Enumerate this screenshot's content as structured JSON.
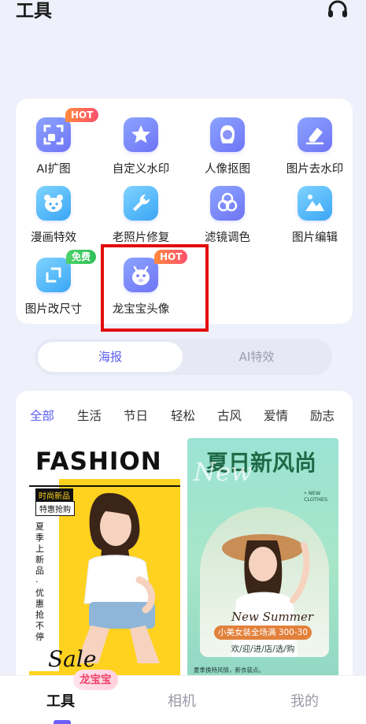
{
  "header": {
    "title": "工具"
  },
  "tools": [
    {
      "label": "AI扩图",
      "icon": "expand-icon",
      "badge": "HOT"
    },
    {
      "label": "自定义水印",
      "icon": "star-icon"
    },
    {
      "label": "人像抠图",
      "icon": "portrait-icon"
    },
    {
      "label": "图片去水印",
      "icon": "eraser-icon"
    },
    {
      "label": "漫画特效",
      "icon": "bear-icon"
    },
    {
      "label": "老照片修复",
      "icon": "wrench-icon"
    },
    {
      "label": "滤镜调色",
      "icon": "color-filter-icon"
    },
    {
      "label": "图片编辑",
      "icon": "image-edit-icon"
    },
    {
      "label": "图片改尺寸",
      "icon": "resize-icon",
      "badge": "免费"
    },
    {
      "label": "龙宝宝头像",
      "icon": "dragon-avatar-icon",
      "badge": "HOT"
    }
  ],
  "segments": {
    "active": "海报",
    "inactive": "AI特效"
  },
  "categories": [
    "全部",
    "生活",
    "节日",
    "轻松",
    "古风",
    "爱情",
    "励志"
  ],
  "posters": {
    "fashion": {
      "headline": "FASHION",
      "tag1": "时尚新品",
      "tag2": "特惠抢购",
      "vertical": "夏季上新品·优惠抢不停",
      "script": "Sale"
    },
    "summer": {
      "headline": "夏日新风尚",
      "script_top": "New",
      "corner": "• NEW CLOTHES",
      "script": "New Summer",
      "banner": "小美女装全场满 300-30",
      "slogan": "欢/迎/进/店/选/购",
      "footer": "夏季换特风情，新衣装点。"
    }
  },
  "tabbar": {
    "tools": "工具",
    "camera": "相机",
    "mine": "我的",
    "bubble": "龙宝宝"
  },
  "colors": {
    "accent": "#5b5ff0",
    "highlight_box": "#e30b0b",
    "hot_badge": "#ff5a5f",
    "free_badge": "#34c759"
  }
}
